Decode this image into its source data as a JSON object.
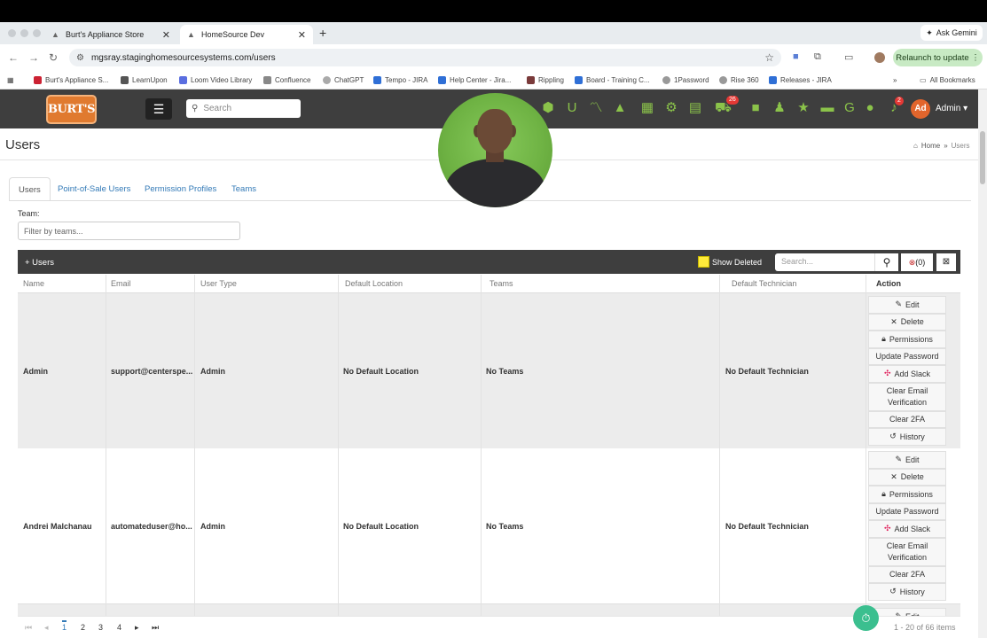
{
  "browser": {
    "tabs": [
      {
        "label": "Burt's Appliance Store"
      },
      {
        "label": "HomeSource Dev"
      }
    ],
    "ask_gemini": "Ask Gemini",
    "url": "mgsray.staginghomesourcesystems.com/users",
    "relaunch": "Relaunch to update",
    "bookmarks": [
      "Burt's Appliance S...",
      "LearnUpon",
      "Loom Video Library",
      "Confluence",
      "ChatGPT",
      "Tempo - JIRA",
      "Help Center - Jira...",
      "Rippling",
      "Board - Training C...",
      "1Password",
      "Rise 360",
      "Releases - JIRA"
    ],
    "all_bookmarks": "All Bookmarks"
  },
  "app": {
    "logo": "BURT'S",
    "search_placeholder": "Search",
    "cart_badge": "26",
    "bell_badge": "2",
    "avatar_initials": "Ad",
    "user_menu": "Admin"
  },
  "page": {
    "title": "Users",
    "breadcrumb": [
      "Home",
      "Users"
    ],
    "tabs": [
      "Users",
      "Point-of-Sale Users",
      "Permission Profiles",
      "Teams"
    ],
    "team_label": "Team:",
    "team_placeholder": "Filter by teams..."
  },
  "grid": {
    "add_label": "+ Users",
    "show_deleted": "Show Deleted",
    "search_placeholder": "Search...",
    "filter_count": "(0)",
    "columns": [
      "Name",
      "Email",
      "User Type",
      "Default Location",
      "Teams",
      "Default Technician",
      "Action"
    ],
    "rows": [
      {
        "name": "Admin",
        "email": "support@centerspe...",
        "user_type": "Admin",
        "location": "No Default Location",
        "teams": "No Teams",
        "technician": "No Default Technician"
      },
      {
        "name": "Andrei Malchanau",
        "email": "automateduser@ho...",
        "user_type": "Admin",
        "location": "No Default Location",
        "teams": "No Teams",
        "technician": "No Default Technician"
      }
    ],
    "actions": {
      "edit": "Edit",
      "delete": "Delete",
      "permissions": "Permissions",
      "update_password": "Update Password",
      "add_slack": "Add Slack",
      "clear_email_1": "Clear Email",
      "clear_email_2": "Verification",
      "clear_2fa": "Clear 2FA",
      "history": "History"
    },
    "pages": [
      "1",
      "2",
      "3",
      "4"
    ],
    "page_info": "1 - 20 of 66 items"
  },
  "colors": {
    "header_bg": "#3e3e3e",
    "icon_green": "#8bc34a",
    "link_blue": "#337ab7",
    "logo_orange": "#e07a2f"
  }
}
